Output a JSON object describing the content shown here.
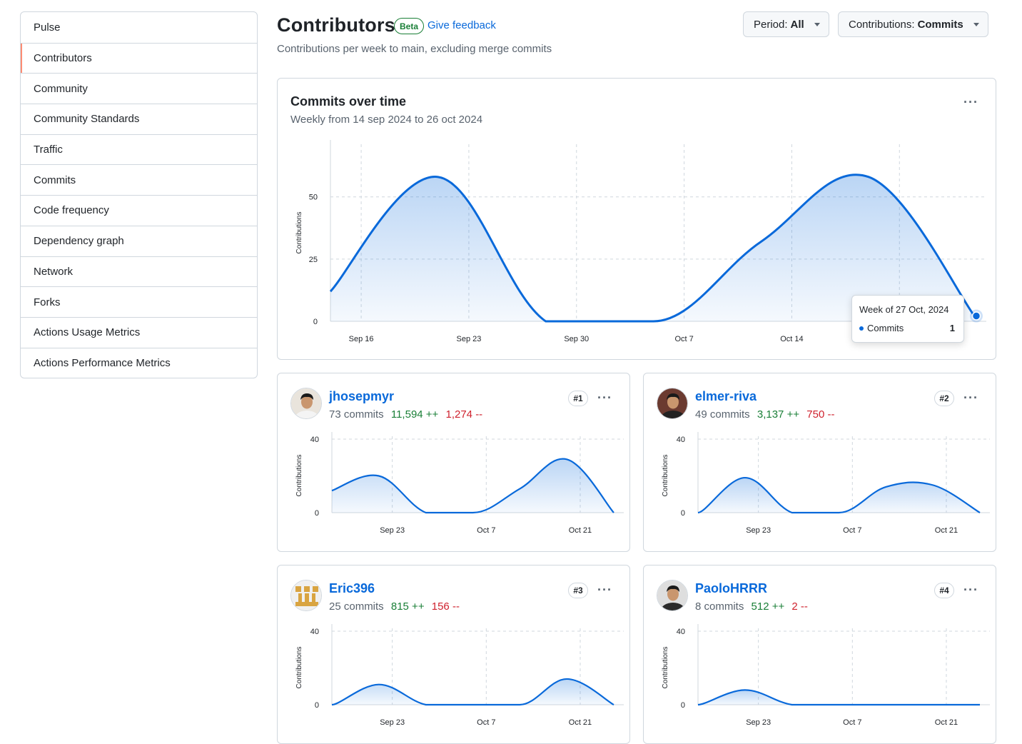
{
  "sidebar": {
    "items": [
      {
        "label": "Pulse"
      },
      {
        "label": "Contributors",
        "active": true
      },
      {
        "label": "Community"
      },
      {
        "label": "Community Standards"
      },
      {
        "label": "Traffic"
      },
      {
        "label": "Commits"
      },
      {
        "label": "Code frequency"
      },
      {
        "label": "Dependency graph"
      },
      {
        "label": "Network"
      },
      {
        "label": "Forks"
      },
      {
        "label": "Actions Usage Metrics"
      },
      {
        "label": "Actions Performance Metrics"
      }
    ]
  },
  "header": {
    "title": "Contributors",
    "badge": "Beta",
    "feedback_link": "Give feedback",
    "subtitle": "Contributions per week to main, excluding merge commits",
    "period_label": "Period:",
    "period_value": "All",
    "contrib_label": "Contributions:",
    "contrib_value": "Commits"
  },
  "main_chart": {
    "title": "Commits over time",
    "subtitle": "Weekly from 14 sep 2024 to 26 oct 2024",
    "tooltip": {
      "title": "Week of 27 Oct, 2024",
      "series": "Commits",
      "value": "1"
    }
  },
  "colors": {
    "accent": "#0969da",
    "add": "#1a7f37",
    "del": "#cf222e",
    "active": "#fd8c73"
  },
  "contributors": [
    {
      "name": "jhosepmyr",
      "commits": "73 commits",
      "additions": "11,594 ++",
      "deletions": "1,274 --",
      "rank": "#1",
      "avatar": "person-photo"
    },
    {
      "name": "elmer-riva",
      "commits": "49 commits",
      "additions": "3,137 ++",
      "deletions": "750 --",
      "rank": "#2",
      "avatar": "person-photo"
    },
    {
      "name": "Eric396",
      "commits": "25 commits",
      "additions": "815 ++",
      "deletions": "156 --",
      "rank": "#3",
      "avatar": "identicon"
    },
    {
      "name": "PaoloHRRR",
      "commits": "8 commits",
      "additions": "512 ++",
      "deletions": "2 --",
      "rank": "#4",
      "avatar": "person-photo"
    }
  ],
  "chart_data": [
    {
      "type": "area",
      "title": "Commits over time",
      "ylabel": "Contributions",
      "ylim": [
        0,
        70
      ],
      "yticks": [
        "0",
        "25",
        "50"
      ],
      "xticks": [
        "Sep 16",
        "Sep 23",
        "Sep 30",
        "Oct 7",
        "Oct 14",
        "Oct 21"
      ],
      "x": [
        "Sep 14",
        "Sep 21",
        "Sep 28",
        "Oct 5",
        "Oct 12",
        "Oct 19",
        "Oct 26"
      ],
      "series": [
        {
          "name": "Commits",
          "values": [
            12,
            58,
            0,
            0,
            32,
            58,
            1
          ]
        }
      ]
    },
    {
      "type": "area",
      "ylabel": "Contributions",
      "ylim": [
        0,
        40
      ],
      "yticks": [
        "0",
        "40"
      ],
      "xticks": [
        "Sep 23",
        "Oct 7",
        "Oct 21"
      ],
      "x": [
        "Sep 14",
        "Sep 21",
        "Sep 28",
        "Oct 5",
        "Oct 12",
        "Oct 19",
        "Oct 26"
      ],
      "series": [
        {
          "values": [
            12,
            20,
            0,
            0,
            13,
            29,
            0
          ]
        }
      ]
    },
    {
      "type": "area",
      "ylabel": "Contributions",
      "ylim": [
        0,
        40
      ],
      "yticks": [
        "0",
        "40"
      ],
      "xticks": [
        "Sep 23",
        "Oct 7",
        "Oct 21"
      ],
      "x": [
        "Sep 14",
        "Sep 21",
        "Sep 28",
        "Oct 5",
        "Oct 12",
        "Oct 19",
        "Oct 26"
      ],
      "series": [
        {
          "values": [
            0,
            19,
            0,
            0,
            14,
            15,
            0
          ]
        }
      ]
    },
    {
      "type": "area",
      "ylabel": "Contributions",
      "ylim": [
        0,
        40
      ],
      "yticks": [
        "0",
        "40"
      ],
      "xticks": [
        "Sep 23",
        "Oct 7",
        "Oct 21"
      ],
      "x": [
        "Sep 14",
        "Sep 21",
        "Sep 28",
        "Oct 5",
        "Oct 12",
        "Oct 19",
        "Oct 26"
      ],
      "series": [
        {
          "values": [
            0,
            11,
            0,
            0,
            0,
            14,
            0
          ]
        }
      ]
    },
    {
      "type": "area",
      "ylabel": "Contributions",
      "ylim": [
        0,
        40
      ],
      "yticks": [
        "0",
        "40"
      ],
      "xticks": [
        "Sep 23",
        "Oct 7",
        "Oct 21"
      ],
      "x": [
        "Sep 14",
        "Sep 21",
        "Sep 28",
        "Oct 5",
        "Oct 12",
        "Oct 19",
        "Oct 26"
      ],
      "series": [
        {
          "values": [
            0,
            8,
            0,
            0,
            0,
            0,
            0
          ]
        }
      ]
    }
  ]
}
